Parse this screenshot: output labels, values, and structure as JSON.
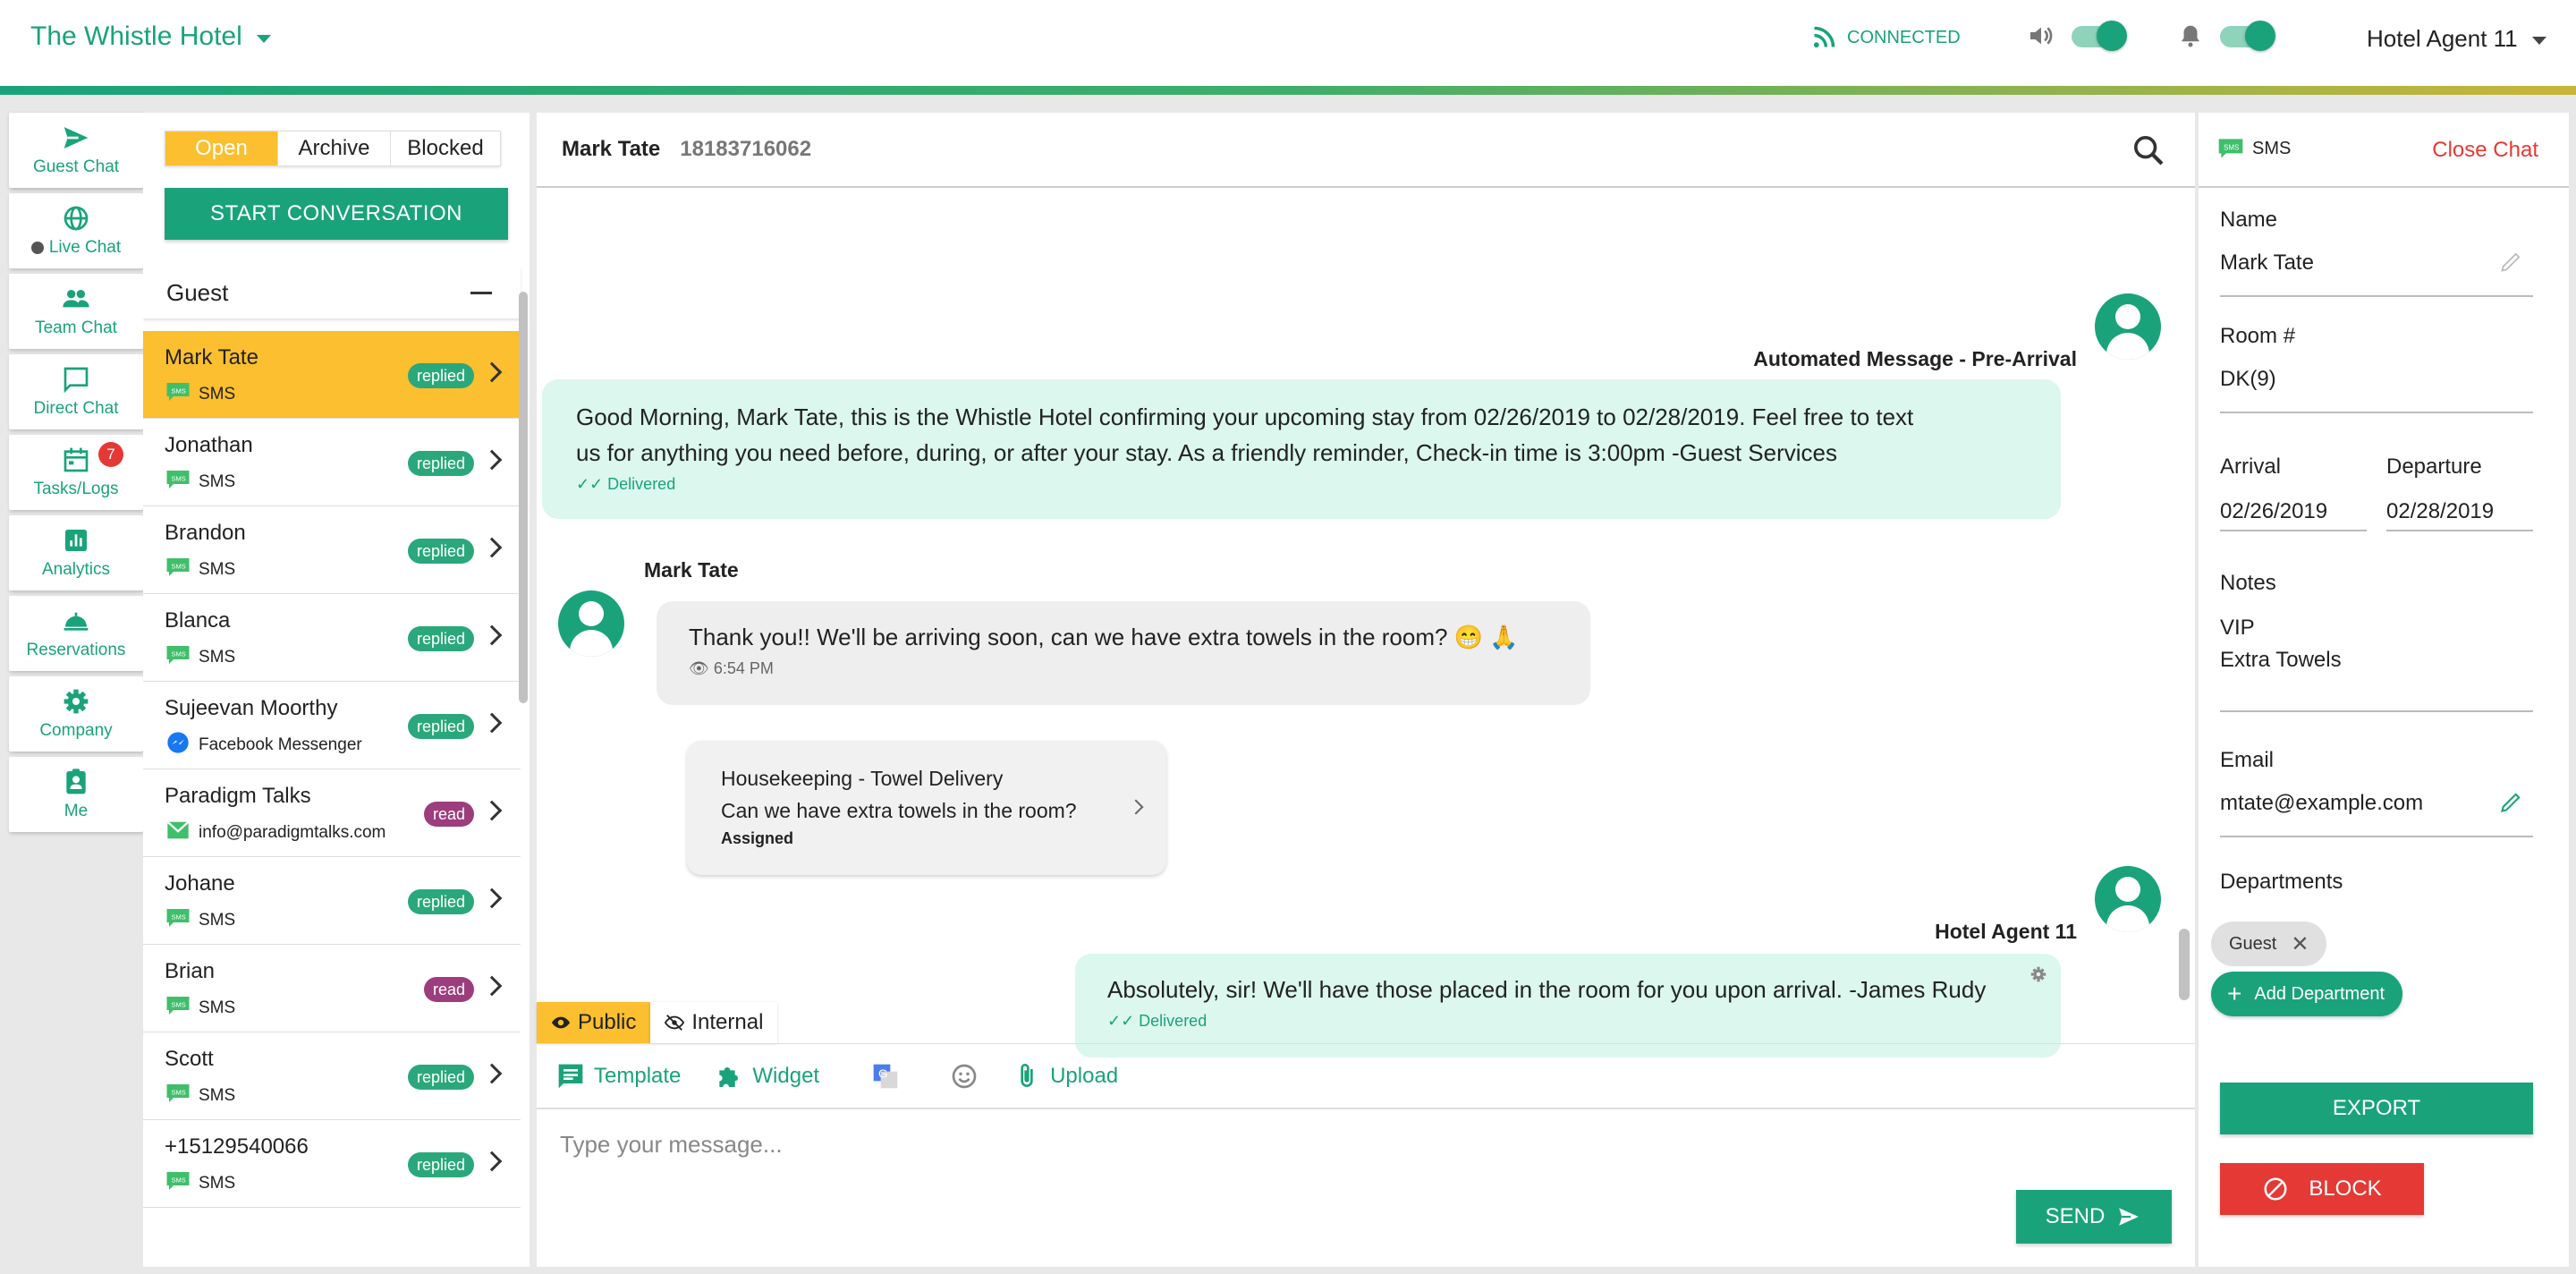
{
  "header": {
    "hotel_name": "The Whistle Hotel",
    "connection_status": "CONNECTED",
    "agent_name": "Hotel Agent 11"
  },
  "nav": {
    "items": [
      {
        "label": "Guest Chat",
        "icon": "send-icon"
      },
      {
        "label": "Live Chat",
        "icon": "globe-icon"
      },
      {
        "label": "Team Chat",
        "icon": "people-icon"
      },
      {
        "label": "Direct Chat",
        "icon": "chat-bubble-icon"
      },
      {
        "label": "Tasks/Logs",
        "icon": "calendar-icon",
        "badge": "7"
      },
      {
        "label": "Analytics",
        "icon": "bar-chart-icon"
      },
      {
        "label": "Reservations",
        "icon": "bell-service-icon"
      },
      {
        "label": "Company",
        "icon": "gear-icon"
      },
      {
        "label": "Me",
        "icon": "badge-icon"
      }
    ]
  },
  "conversations": {
    "filters": [
      "Open",
      "Archive",
      "Blocked"
    ],
    "active_filter": "Open",
    "start_label": "START CONVERSATION",
    "group_label": "Guest",
    "items": [
      {
        "name": "Mark Tate",
        "channel": "SMS",
        "status": "replied"
      },
      {
        "name": "Jonathan",
        "channel": "SMS",
        "status": "replied"
      },
      {
        "name": "Brandon",
        "channel": "SMS",
        "status": "replied"
      },
      {
        "name": "Blanca",
        "channel": "SMS",
        "status": "replied"
      },
      {
        "name": "Sujeevan Moorthy",
        "channel": "Facebook Messenger",
        "status": "replied"
      },
      {
        "name": "Paradigm Talks",
        "channel": "info@paradigmtalks.com",
        "status": "read"
      },
      {
        "name": "Johane",
        "channel": "SMS",
        "status": "replied"
      },
      {
        "name": "Brian",
        "channel": "SMS",
        "status": "read"
      },
      {
        "name": "Scott",
        "channel": "SMS",
        "status": "replied"
      },
      {
        "name": "+15129540066",
        "channel": "SMS",
        "status": "replied"
      }
    ]
  },
  "chat": {
    "contact_name": "Mark Tate",
    "contact_phone": "18183716062",
    "messages": {
      "m1_label": "Automated Message - Pre-Arrival",
      "m1_line1": "Good Morning, Mark Tate, this is the Whistle Hotel confirming your upcoming stay from 02/26/2019 to 02/28/2019. Feel free to text",
      "m1_line2": "us for anything you need before, during, or after your stay. As a friendly reminder, Check-in time is 3:00pm -Guest Services",
      "m1_status": "Delivered",
      "m2_sender": "Mark Tate",
      "m2_text": "Thank you!! We'll be arriving soon, can we have extra towels in the room? 😁 🙏",
      "m2_time": "6:54 PM",
      "task_title": "Housekeeping - Towel Delivery",
      "task_text": "Can we have extra towels in the room?",
      "task_status": "Assigned",
      "m3_sender": "Hotel Agent 11",
      "m3_text": "Absolutely, sir! We'll have those placed in the room for you upon arrival. -James Rudy",
      "m3_status": "Delivered"
    },
    "tabs": {
      "public": "Public",
      "internal": "Internal"
    },
    "tools": {
      "template": "Template",
      "widget": "Widget",
      "upload": "Upload"
    },
    "input_placeholder": "Type your message...",
    "send_label": "SEND"
  },
  "details": {
    "channel": "SMS",
    "close_label": "Close Chat",
    "name_label": "Name",
    "name_value": "Mark Tate",
    "room_label": "Room #",
    "room_value": "DK(9)",
    "arrival_label": "Arrival",
    "arrival_value": "02/26/2019",
    "departure_label": "Departure",
    "departure_value": "02/28/2019",
    "notes_label": "Notes",
    "notes_line1": "VIP",
    "notes_line2": "Extra Towels",
    "email_label": "Email",
    "email_value": "mtate@example.com",
    "departments_label": "Departments",
    "department_chip": "Guest",
    "add_department_label": "Add Department",
    "export_label": "EXPORT",
    "block_label": "BLOCK"
  },
  "colors": {
    "primary": "#1aa37a",
    "accent": "#fbbf2f",
    "danger": "#e53935",
    "read_badge": "#9c3d7e"
  }
}
